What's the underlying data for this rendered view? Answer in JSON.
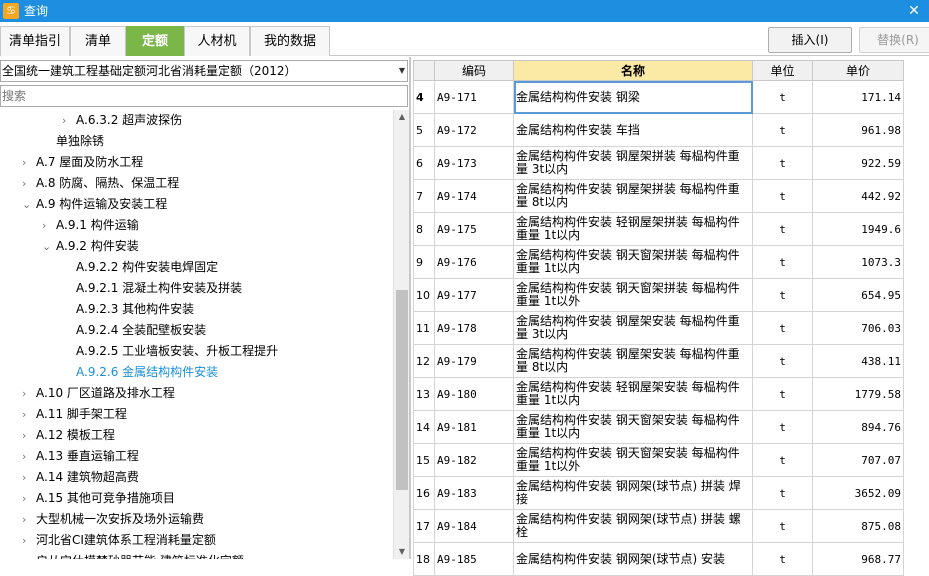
{
  "window": {
    "title": "查询",
    "app_icon_glyph": "♋"
  },
  "tabs": [
    {
      "label": "清单指引"
    },
    {
      "label": "清单"
    },
    {
      "label": "定额"
    },
    {
      "label": "人材机"
    },
    {
      "label": "我的数据"
    }
  ],
  "toolbar": {
    "insert_label": "插入(I)",
    "replace_label": "替换(R)"
  },
  "left": {
    "dropdown_value": "全国统一建筑工程基础定额河北省消耗量定额（2012）",
    "search_placeholder": "搜索",
    "tree": [
      {
        "label": "A.6.3.2 超声波探伤",
        "level": 3,
        "arrow": "›"
      },
      {
        "label": "单独除锈",
        "level": 2,
        "arrow": ""
      },
      {
        "label": "A.7 屋面及防水工程",
        "level": 1,
        "arrow": "›"
      },
      {
        "label": "A.8 防腐、隔热、保温工程",
        "level": 1,
        "arrow": "›"
      },
      {
        "label": "A.9 构件运输及安装工程",
        "level": 1,
        "arrow": "⌄"
      },
      {
        "label": "A.9.1 构件运输",
        "level": 2,
        "arrow": "›"
      },
      {
        "label": "A.9.2 构件安装",
        "level": 2,
        "arrow": "⌄"
      },
      {
        "label": "A.9.2.2 构件安装电焊固定",
        "level": 3,
        "arrow": ""
      },
      {
        "label": "A.9.2.1 混凝土构件安装及拼装",
        "level": 3,
        "arrow": ""
      },
      {
        "label": "A.9.2.3 其他构件安装",
        "level": 3,
        "arrow": ""
      },
      {
        "label": "A.9.2.4 全装配壁板安装",
        "level": 3,
        "arrow": ""
      },
      {
        "label": "A.9.2.5 工业墙板安装、升板工程提升",
        "level": 3,
        "arrow": ""
      },
      {
        "label": "A.9.2.6 金属结构构件安装",
        "level": 3,
        "arrow": "",
        "selected": true
      },
      {
        "label": "A.10 厂区道路及排水工程",
        "level": 1,
        "arrow": "›"
      },
      {
        "label": "A.11 脚手架工程",
        "level": 1,
        "arrow": "›"
      },
      {
        "label": "A.12 模板工程",
        "level": 1,
        "arrow": "›"
      },
      {
        "label": "A.13 垂直运输工程",
        "level": 1,
        "arrow": "›"
      },
      {
        "label": "A.14 建筑物超高费",
        "level": 1,
        "arrow": "›"
      },
      {
        "label": "A.15 其他可竞争措施项目",
        "level": 1,
        "arrow": "›"
      },
      {
        "label": "大型机械一次安拆及场外运输费",
        "level": 1,
        "arrow": "›"
      },
      {
        "label": "河北省CI建筑体系工程消耗量定额",
        "level": 1,
        "arrow": "›"
      },
      {
        "label": "启从宝仕模梦砂器节能 建筑标准化定额",
        "level": 1,
        "arrow": "›"
      }
    ]
  },
  "grid": {
    "headers": [
      "",
      "编码",
      "名称",
      "单位",
      "单价"
    ],
    "rows": [
      {
        "n": "4",
        "code": "A9-171",
        "name": "金属结构构件安装 钢梁",
        "unit": "t",
        "price": "171.14",
        "current": true
      },
      {
        "n": "5",
        "code": "A9-172",
        "name": "金属结构构件安装 车挡",
        "unit": "t",
        "price": "961.98"
      },
      {
        "n": "6",
        "code": "A9-173",
        "name": "金属结构构件安装 钢屋架拼装 每榀构件重量 3t以内",
        "unit": "t",
        "price": "922.59"
      },
      {
        "n": "7",
        "code": "A9-174",
        "name": "金属结构构件安装 钢屋架拼装 每榀构件重量 8t以内",
        "unit": "t",
        "price": "442.92"
      },
      {
        "n": "8",
        "code": "A9-175",
        "name": "金属结构构件安装 轻钢屋架拼装 每榀构件重量 1t以内",
        "unit": "t",
        "price": "1949.6"
      },
      {
        "n": "9",
        "code": "A9-176",
        "name": "金属结构构件安装 钢天窗架拼装 每榀构件重量 1t以内",
        "unit": "t",
        "price": "1073.3"
      },
      {
        "n": "10",
        "code": "A9-177",
        "name": "金属结构构件安装 钢天窗架拼装 每榀构件重量 1t以外",
        "unit": "t",
        "price": "654.95"
      },
      {
        "n": "11",
        "code": "A9-178",
        "name": "金属结构构件安装 钢屋架安装 每榀构件重量 3t以内",
        "unit": "t",
        "price": "706.03"
      },
      {
        "n": "12",
        "code": "A9-179",
        "name": "金属结构构件安装 钢屋架安装 每榀构件重量 8t以内",
        "unit": "t",
        "price": "438.11"
      },
      {
        "n": "13",
        "code": "A9-180",
        "name": "金属结构构件安装 轻钢屋架安装 每榀构件重量 1t以内",
        "unit": "t",
        "price": "1779.58"
      },
      {
        "n": "14",
        "code": "A9-181",
        "name": "金属结构构件安装 钢天窗架安装 每榀构件重量 1t以内",
        "unit": "t",
        "price": "894.76"
      },
      {
        "n": "15",
        "code": "A9-182",
        "name": "金属结构构件安装 钢天窗架安装 每榀构件重量 1t以外",
        "unit": "t",
        "price": "707.07"
      },
      {
        "n": "16",
        "code": "A9-183",
        "name": "金属结构构件安装 钢网架(球节点) 拼装 焊接",
        "unit": "t",
        "price": "3652.09"
      },
      {
        "n": "17",
        "code": "A9-184",
        "name": "金属结构构件安装 钢网架(球节点) 拼装 螺栓",
        "unit": "t",
        "price": "875.08"
      },
      {
        "n": "18",
        "code": "A9-185",
        "name": "金属结构构件安装 钢网架(球节点) 安装",
        "unit": "t",
        "price": "968.77"
      }
    ]
  }
}
